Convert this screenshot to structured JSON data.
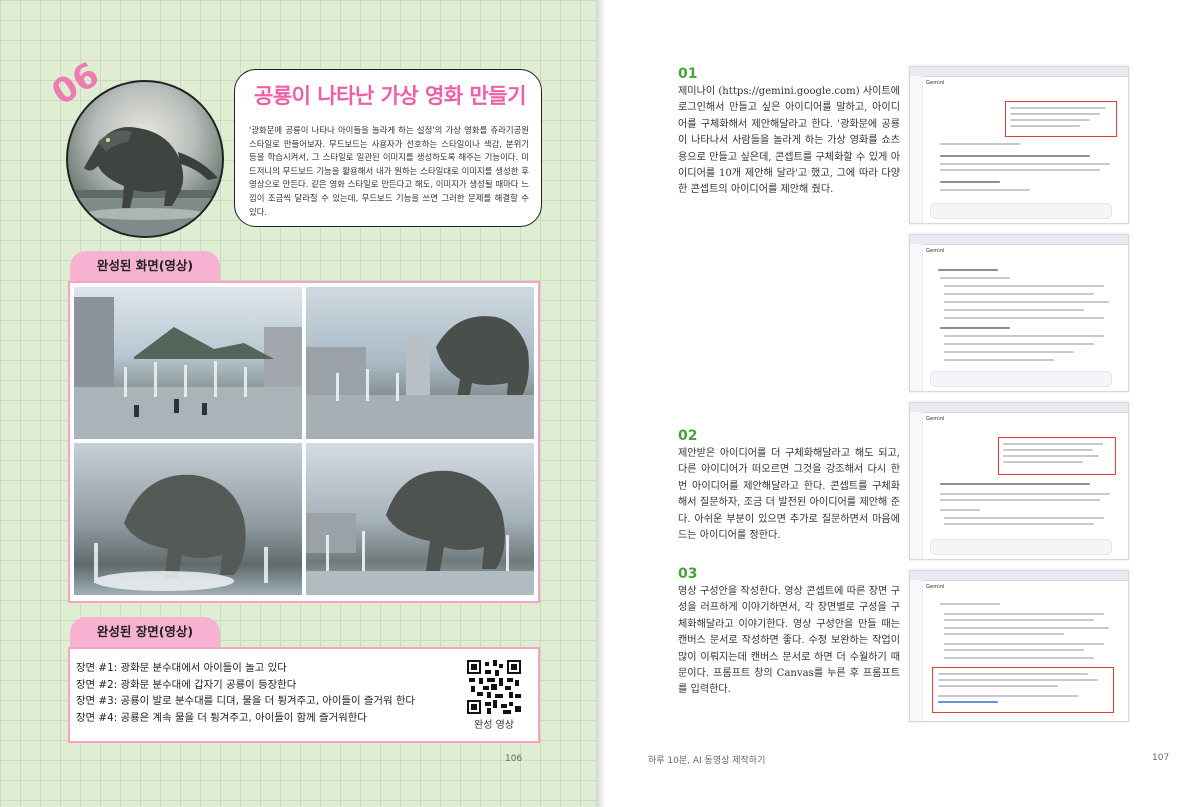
{
  "left": {
    "number": "06",
    "title": "공룡이 나타난 가상 영화 만들기",
    "intro": "'광화문에 공룡이 나타나 아이들을 놀라게 하는 설정'의 가상 영화를 쥬라기공원 스타일로 만들어보자. 무드보드는 사용자가 선호하는 스타일이나 색감, 분위기 등을 학습시켜서, 그 스타일로 일관된 이미지를 생성하도록 해주는 기능이다. 미드저니의 무드보드 기능을 활용해서 내가 원하는 스타일대로 이미지를 생성한 후 영상으로 만든다. 같은 영화 스타일로 만든다고 해도, 이미지가 생성될 때마다 느낌이 조금씩 달라질 수 있는데, 무드보드 기능을 쓰면 그러한 문제를 해결할 수 있다.",
    "section1": "완성된 화면(영상)",
    "section2": "완성된 장면(영상)",
    "scenes": [
      "장면 #1: 광화문 분수대에서 아이들이 놀고 있다",
      "장면 #2: 광화문 분수대에 갑자기 공룡이 등장한다",
      "장면 #3: 공룡이 발로 분수대를 디뎌, 물을 더 튕겨주고, 아이들이 즐거워 한다",
      "장면 #4: 공룡은 계속 물을 더 튕겨주고, 아이들이 함께 즐거워한다"
    ],
    "qr_caption": "완성 영상",
    "page_number": "106"
  },
  "right": {
    "steps": [
      {
        "num": "01",
        "text": "제미나이 (https://gemini.google.com) 사이트에 로그인해서 만들고 싶은 아이디어를 말하고, 아이디어를 구체화해서 제안해달라고 한다. '광화문에 공룡이 나타나서 사람들을 놀라게 하는 가상 영화를 쇼츠용으로 만들고 싶은데, 콘셉트를 구체화할 수 있게 아이디어를 10개 제안해 달라'고 했고, 그에 따라 다양한 콘셉트의 아이디어를 제안해 줬다."
      },
      {
        "num": "02",
        "text": "제안받은 아이디어를 더 구체화해달라고 해도 되고, 다른 아이디어가 떠오르면 그것을 강조해서 다시 한번 아이디어를 제안해달라고 한다. 콘셉트를 구체화해서 질문하자, 조금 더 발전된 아이디어를 제안해 준다. 아쉬운 부분이 있으면 추가로 질문하면서 마음에 드는 아이디어를 정한다."
      },
      {
        "num": "03",
        "text": "영상 구성안을 작성한다. 영상 콘셉트에 따른 장면 구성을 러프하게 이야기하면서, 각 장면별로 구성을 구체화해달라고 이야기한다. 영상 구성안을 만들 때는 캔버스 문서로 작성하면 좋다. 수정 보완하는 작업이 많이 이뤄지는데 캔버스 문서로 하면 더 수월하기 때문이다. 프롬프트 창의 Canvas를 누른 후 프롬프트를 입력한다."
      }
    ],
    "app_name": "Gemini",
    "footer_title": "하루 10분, AI 동영상 제작하기",
    "page_number": "107"
  },
  "colors": {
    "accent_pink": "#ef5fa6",
    "label_pink": "#f7b2d2",
    "step_green": "#4aa23a",
    "grid_bg": "#dfeed3"
  }
}
